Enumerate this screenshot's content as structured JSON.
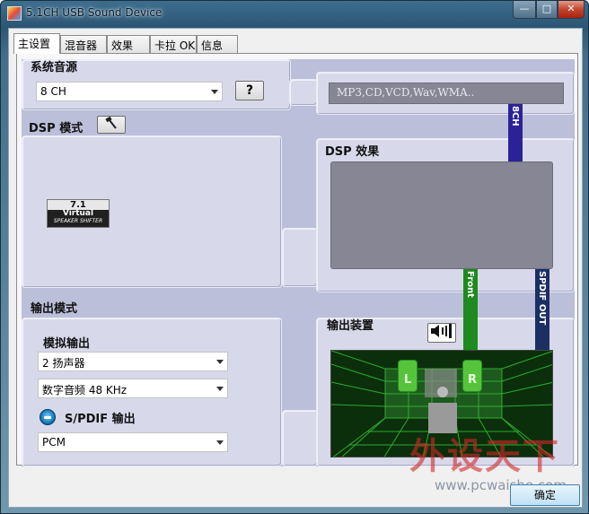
{
  "window": {
    "title": "5.1CH USB Sound Device",
    "min_glyph": "—",
    "max_glyph": "□",
    "close_glyph": "✕"
  },
  "tabs": [
    {
      "label": "主设置",
      "active": true
    },
    {
      "label": "混音器",
      "active": false
    },
    {
      "label": "效果",
      "active": false
    },
    {
      "label": "卡拉 OK",
      "active": false
    },
    {
      "label": "信息",
      "active": false
    }
  ],
  "system_source": {
    "heading": "系统音源",
    "selected": "8 CH",
    "help_label": "?",
    "source_list": "MP3,CD,VCD,Wav,WMA.."
  },
  "dsp_mode": {
    "heading": "DSP 模式",
    "virtual_badge": {
      "line1": "7.1",
      "line2": "Virtual",
      "line3": "SPEAKER SHIFTER"
    }
  },
  "dsp_effect": {
    "heading": "DSP 效果"
  },
  "signal_bars": {
    "top": "8CH",
    "front": "Front",
    "spdif": "SPDIF OUT"
  },
  "output_mode": {
    "heading": "输出模式",
    "analog_heading": "模拟输出",
    "speakers_selected": "2 扬声器",
    "digital_selected": "数字音频 48 KHz",
    "spdif_heading": "S/PDIF 输出",
    "spdif_selected": "PCM"
  },
  "output_device": {
    "heading": "输出装置",
    "speaker_left": "L",
    "speaker_right": "R"
  },
  "footer": {
    "ok_label": "确定"
  },
  "watermark": {
    "brand": "外设天下",
    "url": "www.pcwaishe.com"
  },
  "colors": {
    "display_gray": "#868695",
    "bar_8ch": "#2a2296",
    "bar_front": "#1f8a1f",
    "bar_spdif": "#1b2f63",
    "scene_green": "#0d3a0d",
    "panel_lilac": "#d7d9ea"
  }
}
